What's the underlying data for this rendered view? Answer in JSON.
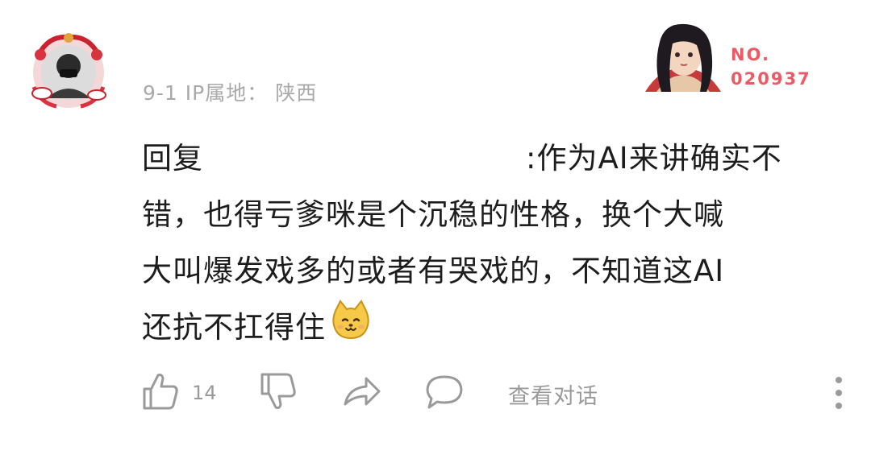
{
  "comment": {
    "date": "9-1",
    "ip_label": "IP属地：",
    "ip_location": "陕西",
    "reply_prefix": "回复",
    "text_line1_tail": ":作为AI来讲确实不",
    "text_line2": "错，也得亏爹咪是个沉稳的性格，换个大喊",
    "text_line3": "大叫爆发戏多的或者有哭戏的，不知道这AI",
    "text_line4": "还抗不扛得住",
    "emoji": "cat-smile-emoji"
  },
  "badge": {
    "label": "NO.",
    "number": "020937"
  },
  "actions": {
    "like_count": "14",
    "view_conversation": "查看对话"
  },
  "colors": {
    "meta_text": "#a9a9a9",
    "badge_text": "#ec5a66",
    "icon": "#9a9a9a",
    "body_text": "#1d1d1d"
  }
}
